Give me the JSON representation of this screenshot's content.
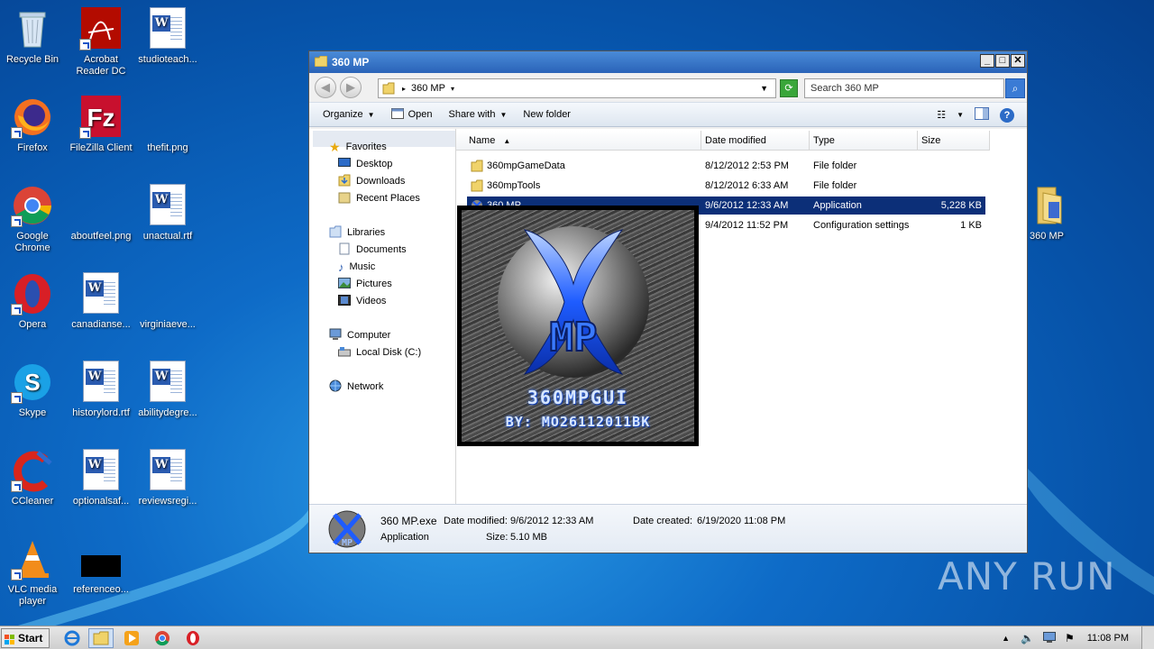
{
  "desktop": {
    "icons": [
      {
        "label": "Recycle Bin"
      },
      {
        "label": "Acrobat Reader DC"
      },
      {
        "label": "studioteach..."
      },
      {
        "label": "Firefox"
      },
      {
        "label": "FileZilla Client"
      },
      {
        "label": "thefit.png"
      },
      {
        "label": "Google Chrome"
      },
      {
        "label": "aboutfeel.png"
      },
      {
        "label": "unactual.rtf"
      },
      {
        "label": "Opera"
      },
      {
        "label": "canadianse..."
      },
      {
        "label": "virginiaeve..."
      },
      {
        "label": "Skype"
      },
      {
        "label": "historylord.rtf"
      },
      {
        "label": "abilitydegre..."
      },
      {
        "label": "CCleaner"
      },
      {
        "label": "optionalsaf..."
      },
      {
        "label": "reviewsregi..."
      },
      {
        "label": "VLC media player"
      },
      {
        "label": "referenceo..."
      },
      {
        "label": "360 MP"
      }
    ]
  },
  "window": {
    "title": "360 MP",
    "address_path": "360 MP",
    "search_placeholder": "Search 360 MP",
    "toolbar": {
      "organize": "Organize",
      "open": "Open",
      "share_with": "Share with",
      "new_folder": "New folder"
    },
    "nav": {
      "favorites": "Favorites",
      "desktop": "Desktop",
      "downloads": "Downloads",
      "recent_places": "Recent Places",
      "libraries": "Libraries",
      "documents": "Documents",
      "music": "Music",
      "pictures": "Pictures",
      "videos": "Videos",
      "computer": "Computer",
      "local_disk": "Local Disk (C:)",
      "network": "Network"
    },
    "columns": {
      "name": "Name",
      "date_modified": "Date modified",
      "type": "Type",
      "size": "Size"
    },
    "files": [
      {
        "name": "360mpGameData",
        "date": "8/12/2012 2:53 PM",
        "type": "File folder",
        "size": ""
      },
      {
        "name": "360mpTools",
        "date": "8/12/2012 6:33 AM",
        "type": "File folder",
        "size": ""
      },
      {
        "name": "360 MP",
        "date": "9/6/2012 12:33 AM",
        "type": "Application",
        "size": "5,228 KB"
      },
      {
        "name": "",
        "date": "9/4/2012 11:52 PM",
        "type": "Configuration settings",
        "size": "1 KB"
      }
    ],
    "details": {
      "filename": "360 MP.exe",
      "date_modified_label": "Date modified:",
      "date_modified": "9/6/2012 12:33 AM",
      "date_created_label": "Date created:",
      "date_created": "6/19/2020 11:08 PM",
      "type": "Application",
      "size_label": "Size:",
      "size": "5.10 MB"
    }
  },
  "splash": {
    "title": "360MPGUI",
    "byline": "BY: MO26112011BK"
  },
  "taskbar": {
    "start_label": "Start",
    "clock": "11:08 PM"
  },
  "watermark": "ANY RUN",
  "colors": {
    "selection": "#0c2f78",
    "title_bar": "#2a63b8",
    "logo_blue": "#1e5cff"
  }
}
